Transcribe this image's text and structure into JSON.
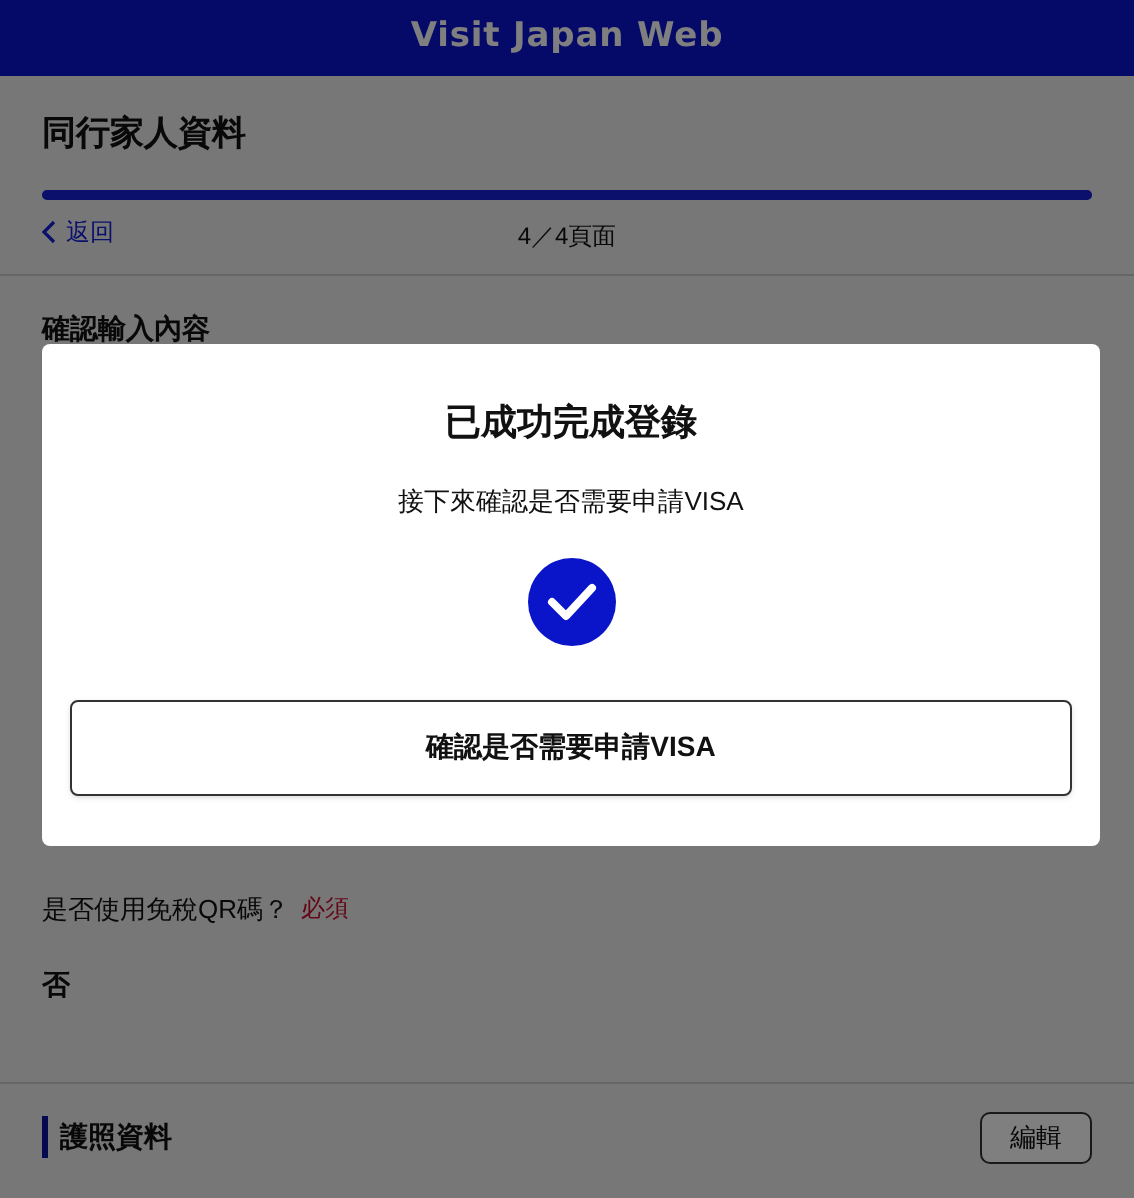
{
  "header": {
    "title": "Visit Japan Web"
  },
  "page": {
    "title": "同行家人資料",
    "progress": {
      "level": 1
    },
    "back": "返回",
    "page_count": "4／4頁面",
    "section": "確認輸入內容",
    "question": {
      "label": "是否使用免稅QR碼？",
      "required": "必須",
      "answer": "否"
    },
    "passport": {
      "title": "護照資料",
      "edit": "編輯"
    }
  },
  "modal": {
    "title": "已成功完成登錄",
    "message": "接下來確認是否需要申請VISA",
    "button": "確認是否需要申請VISA"
  }
}
